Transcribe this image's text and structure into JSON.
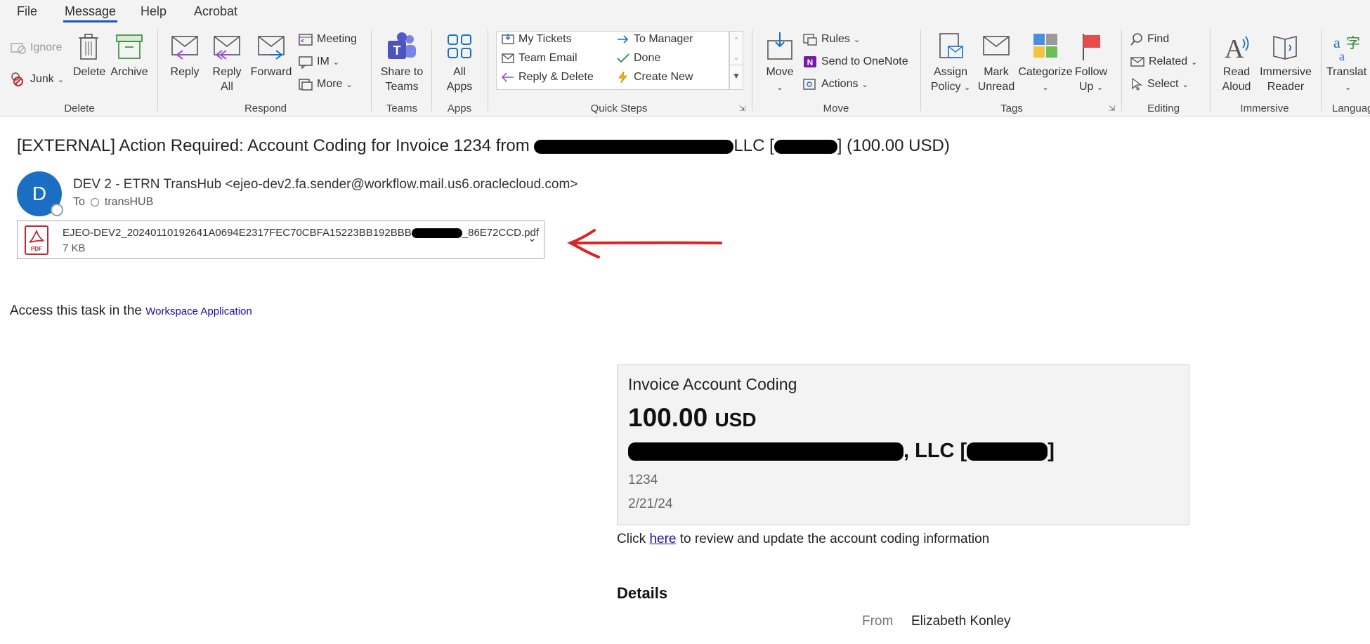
{
  "tabs": [
    "File",
    "Message",
    "Help",
    "Acrobat"
  ],
  "ribbon": {
    "delete_group": {
      "label": "Delete",
      "ignore": "Ignore",
      "junk": "Junk",
      "delete": "Delete",
      "archive": "Archive"
    },
    "respond_group": {
      "label": "Respond",
      "reply": "Reply",
      "reply_all_1": "Reply",
      "reply_all_2": "All",
      "forward": "Forward",
      "meeting": "Meeting",
      "im": "IM",
      "more": "More"
    },
    "teams_group": {
      "label": "Teams",
      "share_1": "Share to",
      "share_2": "Teams"
    },
    "apps_group": {
      "label": "Apps",
      "all_apps_1": "All",
      "all_apps_2": "Apps"
    },
    "quick_steps": {
      "label": "Quick Steps",
      "items": [
        "My Tickets",
        "To Manager",
        "Team Email",
        "Done",
        "Reply & Delete",
        "Create New"
      ]
    },
    "move_group": {
      "label": "Move",
      "move": "Move",
      "rules": "Rules",
      "send_onenote": "Send to OneNote",
      "actions": "Actions"
    },
    "tags_group": {
      "label": "Tags",
      "assign_1": "Assign",
      "assign_2": "Policy",
      "mark_1": "Mark",
      "mark_2": "Unread",
      "categorize": "Categorize",
      "follow_1": "Follow",
      "follow_2": "Up"
    },
    "editing_group": {
      "label": "Editing",
      "find": "Find",
      "related": "Related",
      "select": "Select"
    },
    "immersive_group": {
      "label": "Immersive",
      "read_1": "Read",
      "read_2": "Aloud",
      "reader_1": "Immersive",
      "reader_2": "Reader"
    },
    "language_group": {
      "label": "Languag",
      "translate": "Translat"
    }
  },
  "email": {
    "subject_pre": "[EXTERNAL] Action Required: Account Coding for Invoice 1234 from ",
    "subject_mid": "LLC [",
    "subject_post": "] (100.00 USD)",
    "avatar_initial": "D",
    "sender": "DEV 2 - ETRN TransHub <ejeo-dev2.fa.sender@workflow.mail.us6.oraclecloud.com>",
    "to_label": "To",
    "to_value": "transHUB",
    "attachment_name_pre": "EJEO-DEV2_20240110192641A0694E2317FEC70CBFA15223BB192BBB",
    "attachment_name_post": "_86E72CCD.pdf",
    "attachment_size": "7 KB",
    "access_text": "Access this task in the ",
    "access_link": "Workspace Application",
    "card": {
      "title": "Invoice Account Coding",
      "amount": "100.00",
      "currency": "USD",
      "vendor_suffix": ", LLC [",
      "vendor_close": "]",
      "invoice_number": "1234",
      "date": "2/21/24"
    },
    "click_pre": "Click ",
    "click_link": "here",
    "click_post": " to review and update the account coding information",
    "details_heading": "Details",
    "from_label": "From",
    "from_value": "Elizabeth Konley"
  }
}
